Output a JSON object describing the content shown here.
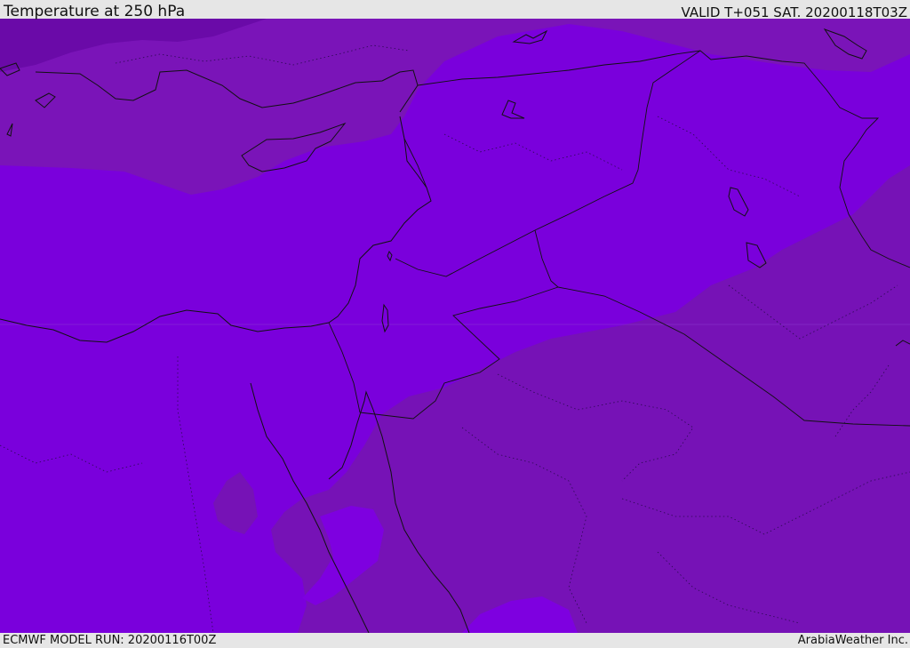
{
  "header": {
    "title": "Temperature at 250 hPa",
    "valid_time": "VALID T+051 SAT. 20200118T03Z"
  },
  "footer": {
    "model_run": "ECMWF MODEL RUN: 20200116T00Z",
    "credit": "ArabiaWeather Inc."
  },
  "map": {
    "field": "Temperature",
    "level": "250 hPa",
    "colors": {
      "coldest": "#6a0aa8",
      "cold": "#7a10b4",
      "cool_band": "#7e00e0",
      "warmer": "#7612b6",
      "borders": "#111111"
    }
  }
}
